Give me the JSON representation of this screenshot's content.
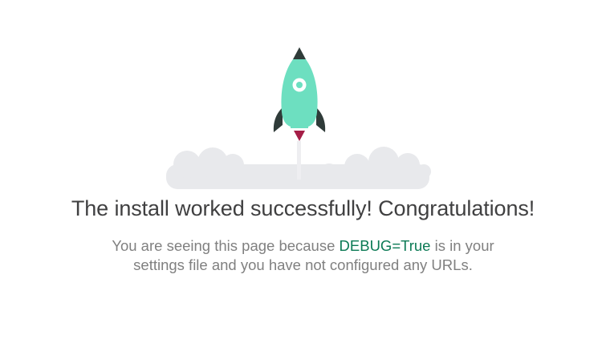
{
  "colors": {
    "rocket_body": "#6ddfc0",
    "rocket_fins": "#2f3b39",
    "rocket_flame": "#a51e47",
    "clouds": "#e8e9ec",
    "heading_text": "#404041",
    "body_text": "#808080",
    "code_text": "#0c7a55"
  },
  "illustration": {
    "icons": [
      "rocket-icon",
      "clouds-icon"
    ]
  },
  "headline": "The install worked successfully! Congratulations!",
  "message": {
    "prefix": "You are seeing this page because ",
    "code": "DEBUG=True",
    "suffix": " is in your settings file and you have not configured any URLs."
  }
}
